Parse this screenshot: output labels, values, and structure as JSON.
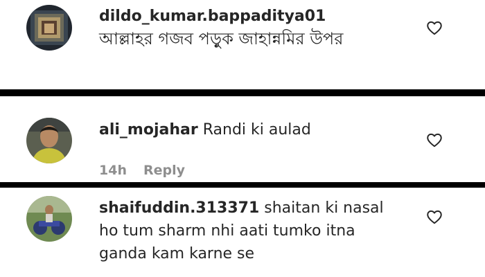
{
  "comments": [
    {
      "username": "dildo_kumar.bappaditya01",
      "text": "আল্লাহর গজব পড়ুক জাহান্নমির উপর",
      "time": "",
      "reply_label": ""
    },
    {
      "username": "ali_mojahar",
      "text": "Randi ki aulad",
      "time": "14h",
      "reply_label": "Reply"
    },
    {
      "username": "shaifuddin.313371",
      "text": "shaitan ki nasal ho tum sharm nhi aati tumko itna ganda kam karne se",
      "time": "",
      "reply_label": ""
    }
  ],
  "icons": {
    "like": "heart-outline-icon"
  },
  "colors": {
    "text": "#262626",
    "meta": "#8e8e8e",
    "divider": "#000000",
    "background": "#ffffff"
  }
}
